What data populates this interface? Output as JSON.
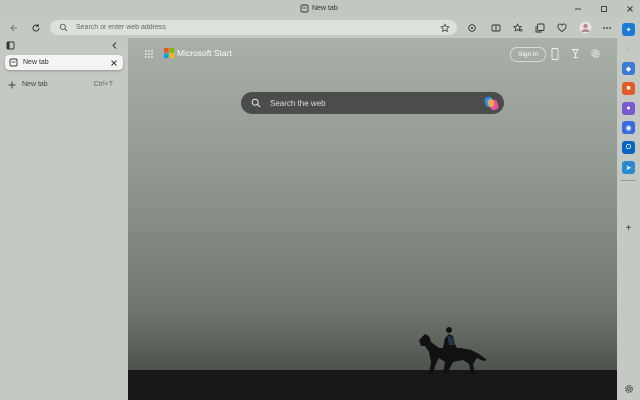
{
  "window": {
    "title": "New tab"
  },
  "omnibox": {
    "placeholder": "Search or enter web address"
  },
  "sidebar": {
    "tabs": [
      {
        "label": "New tab"
      }
    ],
    "new_tab_label": "New tab",
    "new_tab_shortcut": "Ctrl+T"
  },
  "start": {
    "brand": "Microsoft Start",
    "sign_in": "Sign in",
    "search_placeholder": "Search the web"
  },
  "colors": {
    "accent": "#0078d4",
    "copilot": "#7a5af8"
  }
}
